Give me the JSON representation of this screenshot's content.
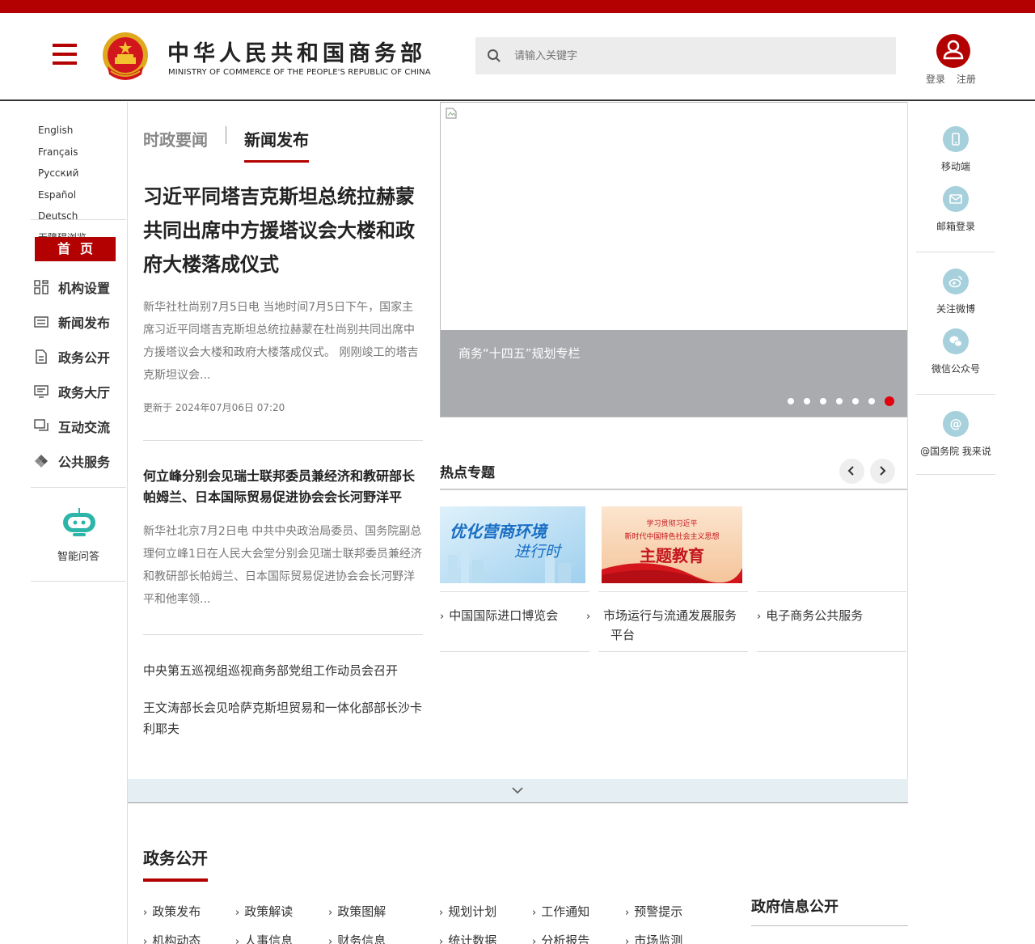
{
  "header": {
    "site_title_cn": "中华人民共和国商务部",
    "site_title_en": "MINISTRY OF COMMERCE OF THE PEOPLE'S REPUBLIC OF CHINA",
    "search_placeholder": "请输入关键字",
    "login_label": "登录",
    "register_label": "注册",
    "brand_color": "#b30000"
  },
  "left_sidebar": {
    "languages": [
      "English",
      "Français",
      "Русский",
      "Español",
      "Deutsch"
    ],
    "accessibility": "无障碍浏览",
    "home_label": "首页",
    "nav": [
      {
        "label": "机构设置",
        "icon": "org-chart-icon"
      },
      {
        "label": "新闻发布",
        "icon": "news-icon"
      },
      {
        "label": "政务公开",
        "icon": "document-icon"
      },
      {
        "label": "政务大厅",
        "icon": "service-hall-icon"
      },
      {
        "label": "互动交流",
        "icon": "chat-icon"
      },
      {
        "label": "公共服务",
        "icon": "public-service-icon"
      }
    ],
    "assistant_label": "智能问答"
  },
  "news": {
    "tabs": [
      "时政要闻",
      "新闻发布"
    ],
    "active_tab": "新闻发布",
    "lead": {
      "title": "习近平同塔吉克斯坦总统拉赫蒙共同出席中方援塔议会大楼和政府大楼落成仪式",
      "summary": "新华社杜尚别7月5日电 当地时间7月5日下午，国家主席习近平同塔吉克斯坦总统拉赫蒙在杜尚别共同出席中方援塔议会大楼和政府大楼落成仪式。 刚刚竣工的塔吉克斯坦议会...",
      "updated": "更新于 2024年07月06日 07:20"
    },
    "second": {
      "title": "何立峰分别会见瑞士联邦委员兼经济和教研部长帕姆兰、日本国际贸易促进协会会长河野洋平",
      "summary": "新华社北京7月2日电 中共中央政治局委员、国务院副总理何立峰1日在人民大会堂分别会见瑞士联邦委员兼经济和教研部长帕姆兰、日本国际贸易促进协会会长河野洋平和他率领..."
    },
    "list": [
      "中央第五巡视组巡视商务部党组工作动员会召开",
      "王文涛部长会见哈萨克斯坦贸易和一体化部部长沙卡利耶夫"
    ]
  },
  "carousel": {
    "caption": "商务“十四五”规划专栏",
    "slide_count": 7,
    "active_index": 7
  },
  "hot_topics": {
    "title": "热点专题",
    "banner1_line1": "优化营商环境",
    "banner1_line2": "进行时",
    "banner2_line1": "学习贯彻习近平",
    "banner2_line2": "新时代中国特色社会主义思想",
    "banner2_line3": "主题教育",
    "links": [
      "中国国际进口博览会",
      "市场运行与流通发展服务平台",
      "电子商务公共服务"
    ]
  },
  "right_sidebar": {
    "items": [
      {
        "label": "移动端",
        "icon": "mobile-icon"
      },
      {
        "label": "邮箱登录",
        "icon": "mail-icon"
      },
      {
        "label": "关注微博",
        "icon": "weibo-icon"
      },
      {
        "label": "微信公众号",
        "icon": "wechat-icon"
      },
      {
        "label": "@国务院 我来说",
        "icon": "at-icon"
      }
    ]
  },
  "gov_affairs": {
    "title": "政务公开",
    "links": [
      "政策发布",
      "政策解读",
      "政策图解",
      "规划计划",
      "工作通知",
      "预警提示",
      "机构动态",
      "人事信息",
      "财务信息",
      "统计数据",
      "分析报告",
      "市场监测"
    ],
    "info_title": "政府信息公开",
    "accent_color": "#b30000",
    "expand_bar_color": "#e4eef3"
  }
}
